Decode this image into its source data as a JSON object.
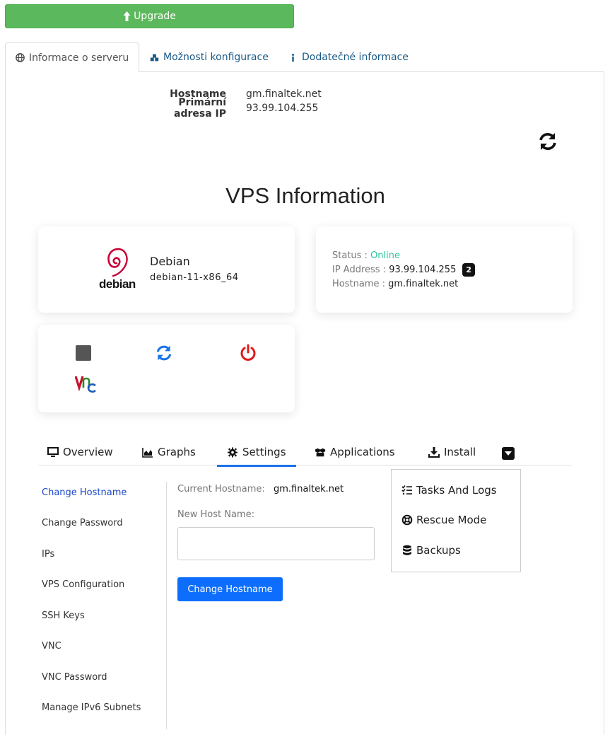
{
  "upgrade": {
    "label": "Upgrade"
  },
  "top_tabs": [
    {
      "label": "Informace o serveru",
      "icon": "globe-icon",
      "active": true
    },
    {
      "label": "Možnosti konfigurace",
      "icon": "cubes-icon",
      "active": false
    },
    {
      "label": "Dodatečné informace",
      "icon": "info-icon",
      "active": false
    }
  ],
  "server_info": {
    "rows": [
      {
        "label": "Hostname",
        "value": "gm.finaltek.net"
      },
      {
        "label": "Primární adresa IP",
        "value": "93.99.104.255"
      }
    ]
  },
  "vps": {
    "title": "VPS Information",
    "os": {
      "logo_text": "debian",
      "name": "Debian",
      "version": "debian-11-x86_64"
    },
    "status": {
      "status_label": "Status :",
      "status_value": "Online",
      "ip_label": "IP Address :",
      "ip_value": "93.99.104.255",
      "ip_badge": "2",
      "hostname_label": "Hostname :",
      "hostname_value": "gm.finaltek.net"
    },
    "actions": [
      {
        "name": "stop",
        "icon": "stop-icon"
      },
      {
        "name": "restart",
        "icon": "refresh-icon"
      },
      {
        "name": "power",
        "icon": "power-icon"
      },
      {
        "name": "vnc",
        "icon": "vnc-icon"
      }
    ]
  },
  "sub_tabs": [
    {
      "label": "Overview",
      "icon": "monitor-icon"
    },
    {
      "label": "Graphs",
      "icon": "area-chart-icon"
    },
    {
      "label": "Settings",
      "icon": "gear-icon",
      "active": true
    },
    {
      "label": "Applications",
      "icon": "boxes-icon"
    },
    {
      "label": "Install",
      "icon": "download-icon"
    }
  ],
  "dropdown": [
    {
      "label": "Tasks And Logs",
      "icon": "tasks-icon"
    },
    {
      "label": "Rescue Mode",
      "icon": "lifebuoy-icon"
    },
    {
      "label": "Backups",
      "icon": "database-icon"
    }
  ],
  "settings_nav": [
    {
      "label": "Change Hostname",
      "active": true
    },
    {
      "label": "Change Password"
    },
    {
      "label": "IPs"
    },
    {
      "label": "VPS Configuration"
    },
    {
      "label": "SSH Keys"
    },
    {
      "label": "VNC"
    },
    {
      "label": "VNC Password"
    },
    {
      "label": "Manage IPv6 Subnets"
    }
  ],
  "hostname_form": {
    "current_label": "Current Hostname:",
    "current_value": "gm.finaltek.net",
    "new_label": "New Host Name:",
    "new_value": "",
    "submit_label": "Change Hostname"
  },
  "colors": {
    "upgrade_green": "#5cb85c",
    "online": "#2ec4a0",
    "primary_blue": "#0d6efd",
    "power_red": "#e01b1b",
    "restart_blue": "#1a73e8"
  }
}
